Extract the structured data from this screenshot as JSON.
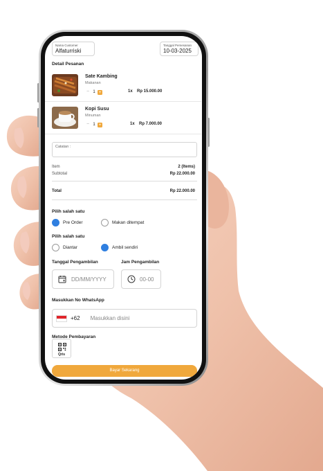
{
  "header": {
    "customer_label": "Nama Customer",
    "customer_name": "Alfaturriski",
    "date_label": "Tanggal Pemesanan",
    "date_value": "10-03-2025"
  },
  "order": {
    "title": "Detail Pesanan",
    "items": [
      {
        "name": "Sate Kambing",
        "category": "Makanan",
        "qty": "1",
        "minus": "−",
        "plus": "+",
        "count": "1x",
        "price": "Rp 15.000.00"
      },
      {
        "name": "Kopi Susu",
        "category": "Minuman",
        "qty": "1",
        "minus": "−",
        "plus": "+",
        "count": "1x",
        "price": "Rp 7.000.00"
      }
    ]
  },
  "notes": {
    "placeholder": "Catatan :"
  },
  "summary": {
    "item_label": "Item",
    "item_value": "2 (Items)",
    "subtotal_label": "Subtotal",
    "subtotal_value": "Rp 22.000.00",
    "total_label": "Total",
    "total_value": "Rp 22.000.00"
  },
  "order_type": {
    "title": "Pilih salah satu",
    "options": [
      "Pre Order",
      "Makan ditempat"
    ],
    "selected": 0
  },
  "pickup_type": {
    "title": "Pilih salah satu",
    "options": [
      "Diantar",
      "Ambil sendiri"
    ],
    "selected": 1
  },
  "pickup_date": {
    "label": "Tanggal Pengambilan",
    "placeholder": "DD/MM/YYYY"
  },
  "pickup_time": {
    "label": "Jam Pengambilan",
    "placeholder": "00-00"
  },
  "whatsapp": {
    "label": "Masukkan No WhatsApp",
    "prefix": "+62",
    "placeholder": "Masukkan disini"
  },
  "payment": {
    "label": "Metode Pembayaran",
    "method": "Qris"
  },
  "pay_button": "Bayar Sekarang",
  "colors": {
    "accent": "#f0a83c",
    "radio_selected": "#2f7fe0",
    "flag_red": "#e0252b"
  },
  "icons": [
    "calendar-icon",
    "clock-icon",
    "indonesia-flag-icon",
    "qr-code-icon",
    "plus-icon",
    "minus-icon"
  ]
}
